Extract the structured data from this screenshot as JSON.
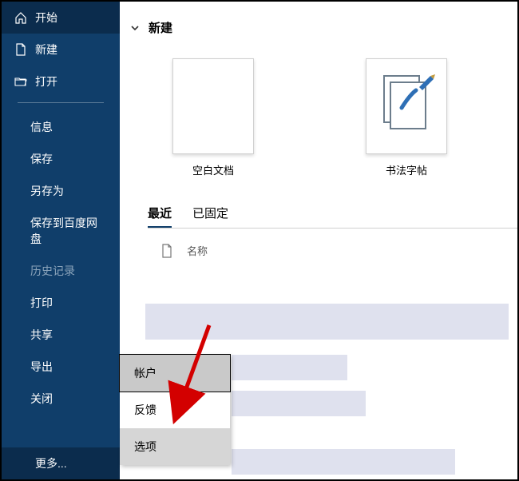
{
  "sidebar": {
    "start": "开始",
    "new": "新建",
    "open": "打开",
    "info": "信息",
    "save": "保存",
    "saveas": "另存为",
    "baidu": "保存到百度网盘",
    "history": "历史记录",
    "print": "打印",
    "share": "共享",
    "export": "导出",
    "close": "关闭",
    "more": "更多..."
  },
  "content": {
    "section_new": "新建",
    "template_blank": "空白文档",
    "template_calligraphy": "书法字帖",
    "tab_recent": "最近",
    "tab_pinned": "已固定",
    "col_name": "名称"
  },
  "submenu": {
    "account": "帐户",
    "feedback": "反馈",
    "options": "选项"
  }
}
